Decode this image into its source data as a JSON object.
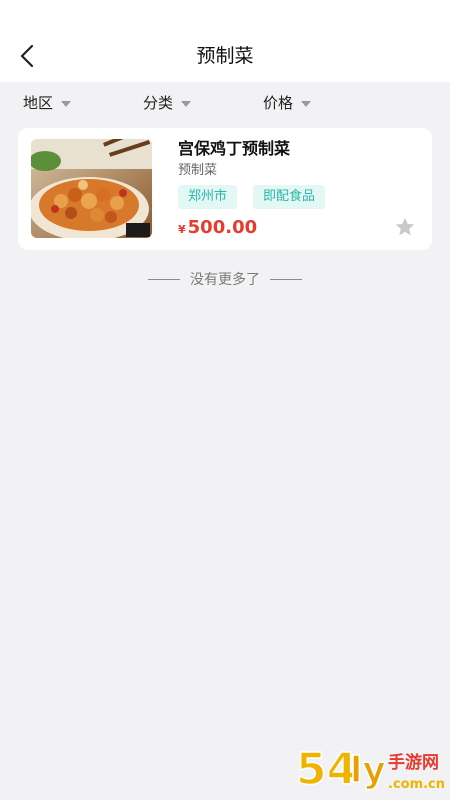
{
  "header": {
    "title": "预制菜",
    "back_icon": "chevron-left-icon"
  },
  "filters": [
    {
      "label": "地区",
      "icon": "caret-down-icon"
    },
    {
      "label": "分类",
      "icon": "caret-down-icon"
    },
    {
      "label": "价格",
      "icon": "caret-down-icon"
    }
  ],
  "products": [
    {
      "name": "宫保鸡丁预制菜",
      "category": "预制菜",
      "tags": [
        "郑州市",
        "即配食品"
      ],
      "currency": "¥",
      "price": "500.00",
      "image": "kung-pao-chicken-photo",
      "favorite_icon": "star-icon"
    }
  ],
  "list_end_text": "没有更多了",
  "watermark": {
    "text": "54ly手游网 .com.cn"
  },
  "colors": {
    "accent_price": "#e63b2e",
    "tag_text": "#2ab7a9",
    "tag_bg": "#e3f7f5",
    "background": "#f2f2f4"
  }
}
